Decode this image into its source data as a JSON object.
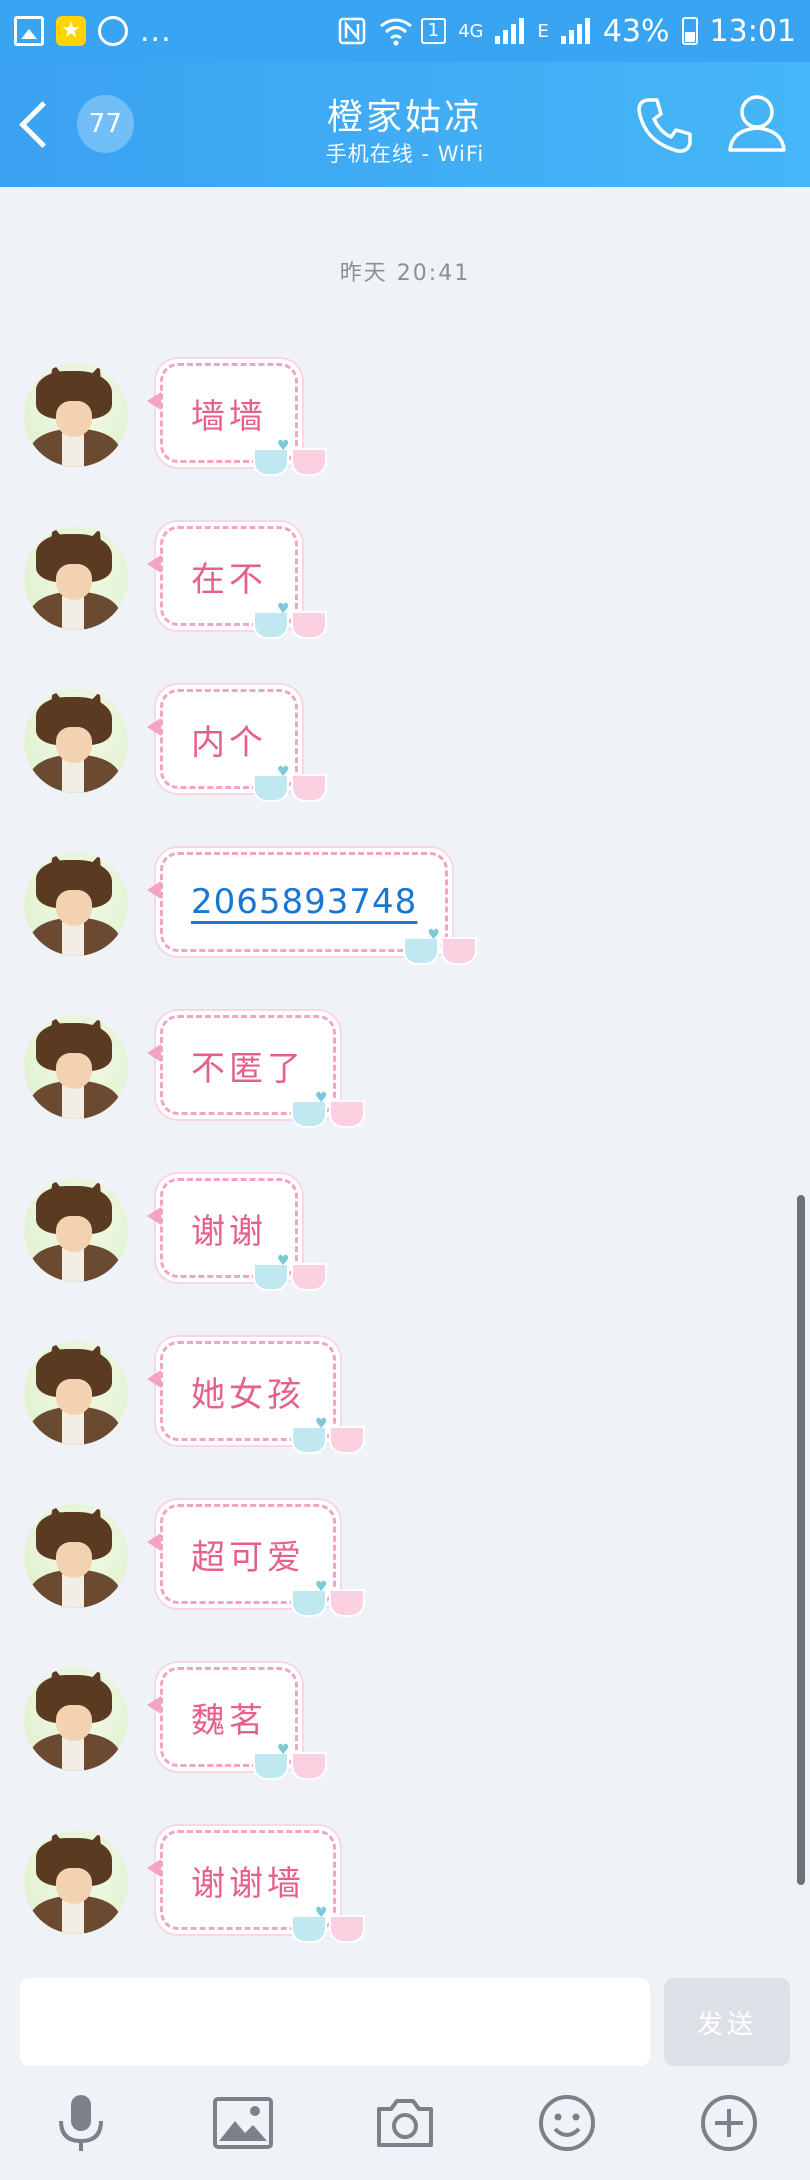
{
  "status_bar": {
    "network_1": "4G",
    "network_2": "E",
    "sim_slot": "1",
    "battery": "43%",
    "time": "13:01",
    "more": "..."
  },
  "header": {
    "back_count": "77",
    "contact_name": "橙家姑凉",
    "contact_status": "手机在线 - WiFi"
  },
  "chat": {
    "timestamp": "昨天 20:41",
    "messages": [
      {
        "text": "墙墙"
      },
      {
        "text": "在不"
      },
      {
        "text": "内个"
      },
      {
        "text": "2065893748"
      },
      {
        "text": "不匿了"
      },
      {
        "text": "谢谢"
      },
      {
        "text": "她女孩"
      },
      {
        "text": "超可爱"
      },
      {
        "text": "魏茗"
      },
      {
        "text": "谢谢墙"
      }
    ]
  },
  "composer": {
    "input_value": "",
    "send_label": "发送"
  },
  "toolbar": {
    "icons": [
      "microphone-icon",
      "image-icon",
      "camera-icon",
      "emoji-icon",
      "plus-icon"
    ]
  },
  "colors": {
    "header_blue": "#3ba2f2",
    "bubble_text_pink": "#e6608f",
    "bubble_border_pink": "#f2a4c2",
    "link_blue": "#1976d2",
    "background": "#eff2f7"
  }
}
